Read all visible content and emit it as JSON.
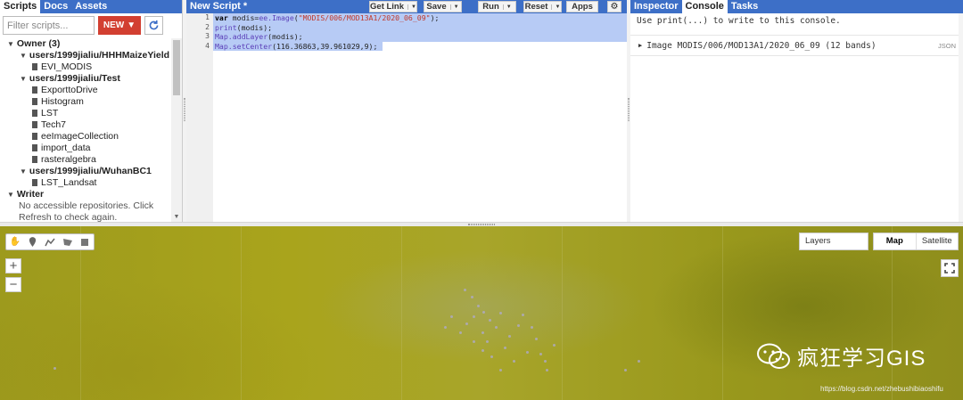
{
  "left_panel": {
    "tabs": [
      "Scripts",
      "Docs",
      "Assets"
    ],
    "filter_placeholder": "Filter scripts...",
    "new_label": "NEW",
    "tree": {
      "owner_label": "Owner (3)",
      "repos": [
        {
          "name": "users/1999jialiu/HHHMaizeYield",
          "files": [
            "EVI_MODIS"
          ]
        },
        {
          "name": "users/1999jialiu/Test",
          "files": [
            "ExporttoDrive",
            "Histogram",
            "LST",
            "Tech7",
            "eeImageCollection",
            "import_data",
            "rasteralgebra"
          ]
        },
        {
          "name": "users/1999jialiu/WuhanBC1",
          "files": [
            "LST_Landsat"
          ]
        }
      ],
      "writer_label": "Writer",
      "writer_note_1": "No accessible repositories. Click",
      "writer_note_2": "Refresh to check again."
    }
  },
  "editor": {
    "title": "New Script *",
    "buttons": {
      "get_link": "Get Link",
      "save": "Save",
      "run": "Run",
      "reset": "Reset",
      "apps": "Apps"
    },
    "line_numbers": [
      "1",
      "2",
      "3",
      "4"
    ],
    "code_lines": [
      "var modis=ee.Image(\"MODIS/006/MOD13A1/2020_06_09\");",
      "print(modis);",
      "Map.addLayer(modis);",
      "Map.setCenter(116.36863,39.961029,9);"
    ]
  },
  "console": {
    "tabs": [
      "Inspector",
      "Console",
      "Tasks"
    ],
    "hint": "Use print(...) to write to this console.",
    "output": "Image MODIS/006/MOD13A1/2020_06_09 (12 bands)",
    "json_label": "JSON"
  },
  "map": {
    "layers_label": "Layers",
    "map_type": [
      "Map",
      "Satellite"
    ],
    "zoom_in": "+",
    "zoom_out": "−",
    "watermark_text": "疯狂学习GIS",
    "watermark_url": "https://blog.csdn.net/zhebushibiaoshifu",
    "colors": {
      "accent": "#3d6fc7",
      "new_button": "#d23f31",
      "map_base": "#a4a022"
    }
  }
}
